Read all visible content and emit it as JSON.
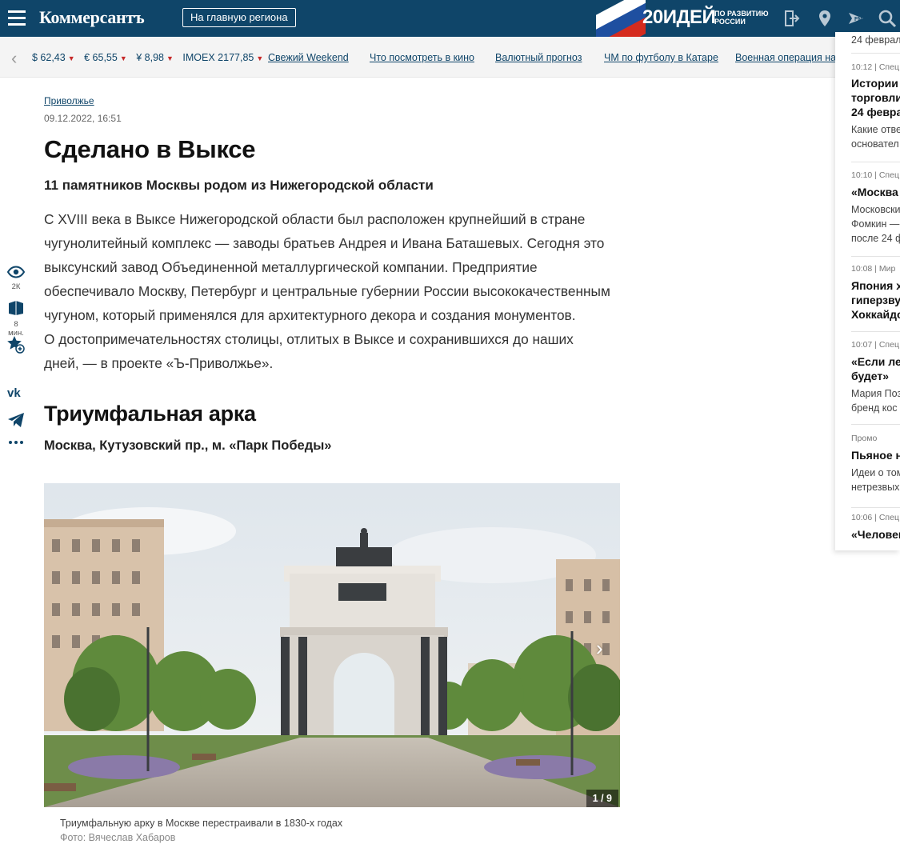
{
  "header": {
    "logo": "Коммерсантъ",
    "region_button": "На главную региона",
    "promo": {
      "number": "20",
      "word": "ИДЕЙ",
      "line1": "ПО РАЗВИТИЮ",
      "line2": "РОССИИ"
    },
    "flag_colors": [
      "#ffffff",
      "#1e4fa0",
      "#d52b1e"
    ],
    "icons": [
      "burger-menu-icon",
      "login-icon",
      "location-pin-icon",
      "radio-icon",
      "search-icon"
    ]
  },
  "ticker": {
    "rates": [
      {
        "label": "$ 62,43"
      },
      {
        "label": "€ 65,55"
      },
      {
        "label": "¥ 8,98"
      },
      {
        "label": "IMOEX 2177,85"
      }
    ],
    "down_marker": "▼",
    "links": [
      "Свежий Weekend",
      "Что посмотреть в кино",
      "Валютный прогноз",
      "ЧМ по футболу в Катаре",
      "Военная операция на У"
    ]
  },
  "feed": {
    "top_text": "24 феврал",
    "items": [
      {
        "meta": "10:12 | Спец",
        "title": [
          "Истории",
          "торговли",
          "24 февра"
        ],
        "sub": [
          "Какие отве",
          "основател"
        ]
      },
      {
        "meta": "10:10 | Спец",
        "title": [
          "«Москва "
        ],
        "sub": [
          "Московски",
          "Фомкин —",
          "после 24 ф"
        ]
      },
      {
        "meta": "10:08 | Мир",
        "title": [
          "Япония х",
          "гиперзву",
          "Хоккайдо"
        ],
        "sub": []
      },
      {
        "meta": "10:07 | Спец",
        "title": [
          "«Если лех",
          "будет»"
        ],
        "sub": [
          "Мария Поз",
          "бренд кос"
        ]
      },
      {
        "meta": "Промо",
        "title": [
          "Пьяное н"
        ],
        "sub": [
          "Идеи о том",
          "нетрезвых"
        ]
      },
      {
        "meta": "10:06 | Спец",
        "title": [
          "«Человек"
        ],
        "sub": []
      }
    ]
  },
  "tools": {
    "views": "2К",
    "read_time": "8 мин."
  },
  "article": {
    "rubric": "Приволжье",
    "date": "09.12.2022, 16:51",
    "title": "Сделано в Выксе",
    "subtitle": "11 памятников Москвы родом из Нижегородской области",
    "lead": [
      "С XVIII века в Выксе Нижегородской области был расположен крупнейший в стране",
      "чугунолитейный комплекс — заводы братьев Андрея и Ивана Баташевых. Сегодня это",
      "выксунский завод Объединенной металлургической компании. Предприятие",
      "обеспечивало Москву, Петербург и центральные губернии России высококачественным",
      "чугуном, который применялся для архитектурного декора и создания монументов.",
      "О достопримечательностях столицы, отлитых в Выксе и сохранившихся до наших",
      "дней, — в проекте «Ъ-Приволжье»."
    ],
    "section_title": "Триумфальная арка",
    "address": "Москва, Кутузовский пр., м. «Парк Победы»",
    "gallery": {
      "counter": "1 / 9",
      "caption": "Триумфальную арку в Москве перестраивали в 1830-х годах",
      "credit": "Фото: Вячеслав Хабаров"
    }
  }
}
